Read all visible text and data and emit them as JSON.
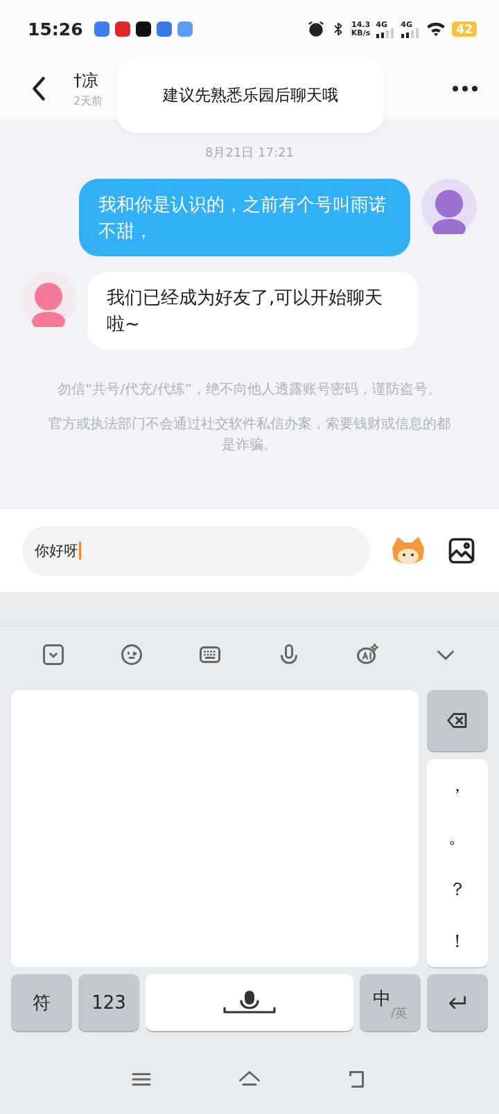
{
  "status_bar": {
    "time": "15:26",
    "net_speed": "14.3",
    "net_unit": "KB/s",
    "networks": [
      "4G",
      "4G"
    ],
    "battery": "42"
  },
  "header": {
    "title": "†凉",
    "subtitle": "2天前"
  },
  "toast": {
    "text": "建议先熟悉乐园后聊天哦"
  },
  "timestamp": "8月21日 17:21",
  "messages": [
    {
      "kind": "sent",
      "text": "我和你是认识的，之前有个号叫雨诺不甜，"
    },
    {
      "kind": "received",
      "text": "我们已经成为好友了,可以开始聊天啦~"
    }
  ],
  "notices": [
    "勿信“共号/代充/代练”，绝不向他人透露账号密码，谨防盗号。",
    "官方或执法部门不会通过社交软件私信办案，索要钱财或信息的都是诈骗。"
  ],
  "input": {
    "value": "你好呀"
  },
  "punctuation": [
    "，",
    "。",
    "？",
    "！"
  ],
  "bottom_keys": {
    "symbols": "符",
    "numbers": "123",
    "lang_main": "中",
    "lang_sep": "/",
    "lang_alt": "英"
  }
}
